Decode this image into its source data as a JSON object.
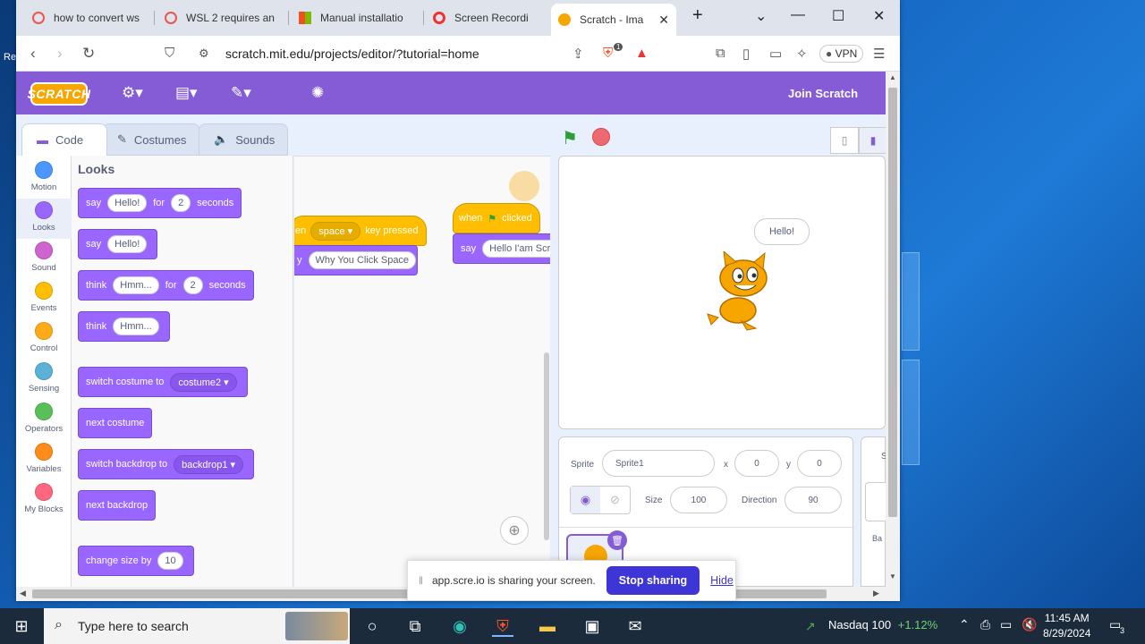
{
  "browser": {
    "tabs": [
      {
        "label": "how to convert ws",
        "color": "#e9584b"
      },
      {
        "label": "WSL 2 requires an",
        "color": "#e9584b"
      },
      {
        "label": "Manual installatio",
        "color": "#0078d4"
      },
      {
        "label": "Screen Recordi",
        "color": "#e33"
      },
      {
        "label": "Scratch - Ima",
        "color": "#f7a600"
      }
    ],
    "new_tab": "+",
    "url": "scratch.mit.edu/projects/editor/?tutorial=home",
    "vpn_label": "VPN",
    "brave_badge": "1"
  },
  "scratch": {
    "logo": "SCRATCH",
    "join": "Join Scratch",
    "tabs": {
      "code": "Code",
      "costumes": "Costumes",
      "sounds": "Sounds"
    },
    "categories": [
      {
        "label": "Motion",
        "color": "#4c97ff"
      },
      {
        "label": "Looks",
        "color": "#9966ff"
      },
      {
        "label": "Sound",
        "color": "#cf63cf"
      },
      {
        "label": "Events",
        "color": "#ffbf00"
      },
      {
        "label": "Control",
        "color": "#ffab19"
      },
      {
        "label": "Sensing",
        "color": "#5cb1d6"
      },
      {
        "label": "Operators",
        "color": "#59c059"
      },
      {
        "label": "Variables",
        "color": "#ff8c1a"
      },
      {
        "label": "My Blocks",
        "color": "#ff6680"
      }
    ],
    "palette": {
      "title": "Looks",
      "b1": {
        "say": "say",
        "val": "Hello!",
        "for": "for",
        "num": "2",
        "sec": "seconds"
      },
      "b2": {
        "say": "say",
        "val": "Hello!"
      },
      "b3": {
        "think": "think",
        "val": "Hmm...",
        "for": "for",
        "num": "2",
        "sec": "seconds"
      },
      "b4": {
        "think": "think",
        "val": "Hmm..."
      },
      "b5": {
        "label": "switch costume to",
        "val": "costume2"
      },
      "b6": {
        "label": "next costume"
      },
      "b7": {
        "label": "switch backdrop to",
        "val": "backdrop1"
      },
      "b8": {
        "label": "next backdrop"
      },
      "b9": {
        "label": "change size by",
        "val": "10"
      }
    },
    "script1": {
      "hat_pre": "en",
      "key": "space",
      "hat_post": "key pressed",
      "say": "y",
      "msg": "Why You Click Space"
    },
    "script2": {
      "when": "when",
      "clicked": "clicked",
      "say": "say",
      "msg": "Hello I'am Scratc"
    },
    "stage": {
      "bubble": "Hello!"
    },
    "sprite": {
      "label": "Sprite",
      "name": "Sprite1",
      "x_label": "x",
      "x": "0",
      "y_label": "y",
      "y": "0",
      "size_label": "Size",
      "size": "100",
      "dir_label": "Direction",
      "dir": "90"
    },
    "backdrop_panel": {
      "s": "S",
      "ba": "Ba"
    }
  },
  "share": {
    "text": "app.scre.io is sharing your screen.",
    "stop": "Stop sharing",
    "hide": "Hide"
  },
  "taskbar": {
    "search": "Type here to search",
    "stock_name": "Nasdaq 100",
    "stock_change": "+1.12%",
    "time": "11:45 AM",
    "date": "8/29/2024",
    "notif": "3"
  },
  "desktop": {
    "left_edge": "Re"
  }
}
